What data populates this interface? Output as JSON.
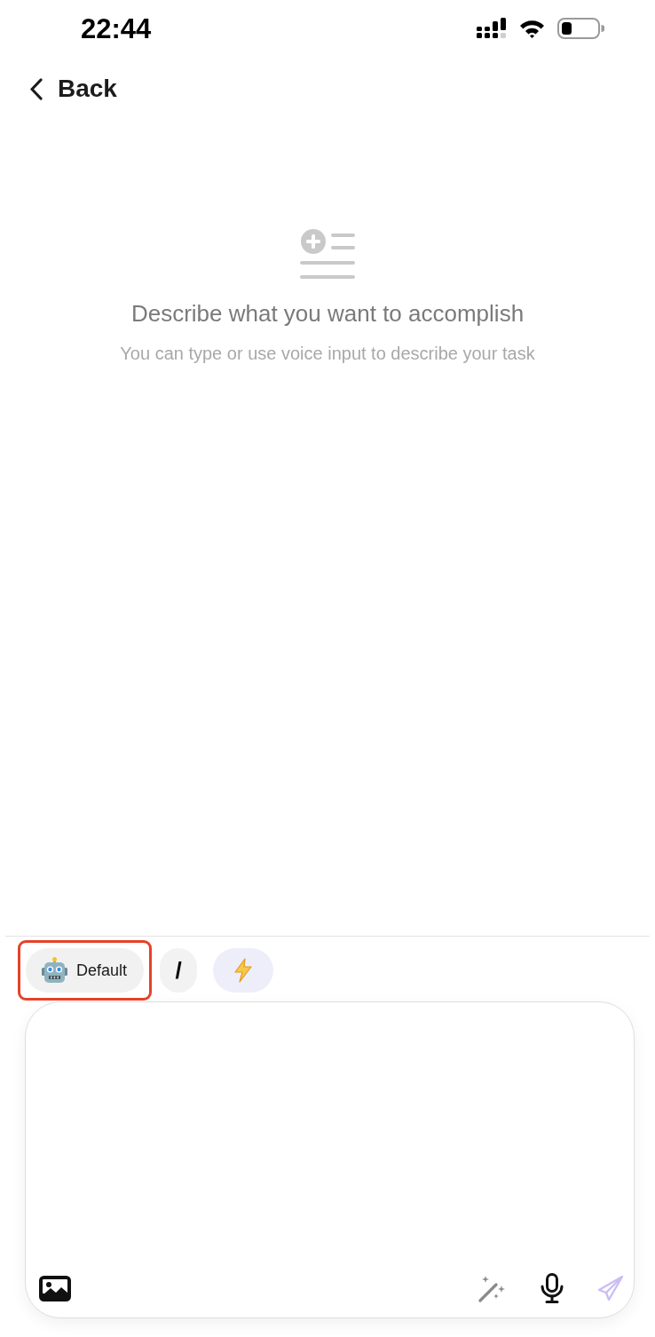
{
  "status_bar": {
    "time": "22:44"
  },
  "nav": {
    "back_label": "Back"
  },
  "empty_state": {
    "title": "Describe what you want to accomplish",
    "subtitle": "You can type or use voice input to describe your task"
  },
  "chips": [
    {
      "kind": "agent",
      "label": "Default",
      "highlighted": true
    },
    {
      "kind": "command",
      "label": "/",
      "highlighted": false
    },
    {
      "kind": "quick",
      "highlighted": false
    }
  ],
  "composer": {
    "send_disabled": true
  }
}
